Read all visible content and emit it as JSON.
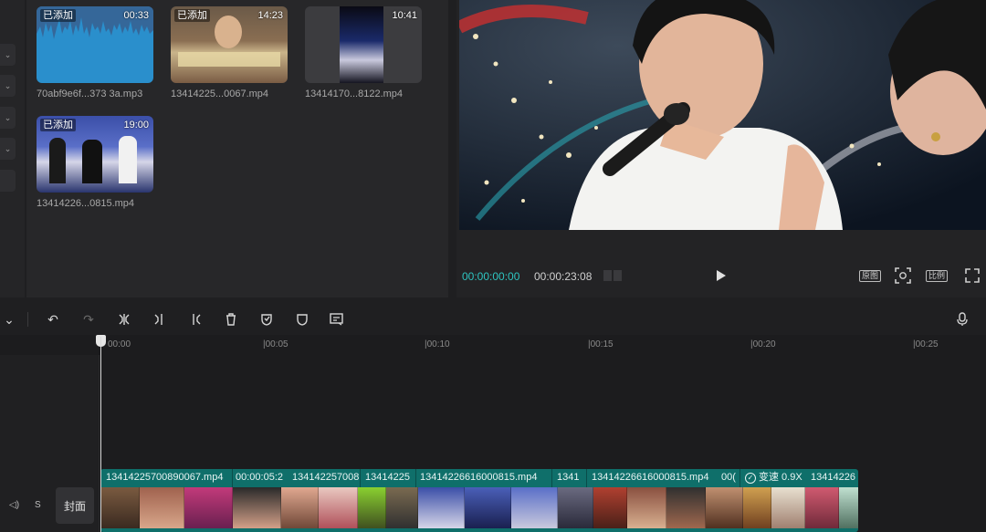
{
  "media": {
    "items": [
      {
        "badge": "已添加",
        "duration": "00:33",
        "filename": "70abf9e6f...373 3a.mp3"
      },
      {
        "badge": "已添加",
        "duration": "14:23",
        "filename": "13414225...0067.mp4"
      },
      {
        "badge": "",
        "duration": "10:41",
        "filename": "13414170...8122.mp4"
      },
      {
        "badge": "已添加",
        "duration": "19:00",
        "filename": "13414226...0815.mp4"
      }
    ]
  },
  "preview": {
    "current_time": "00:00:00:00",
    "total_time": "00:00:23:08",
    "btn_original": "原图",
    "btn_ratio": "比例",
    "colors": {
      "current_time": "#2ec4c0",
      "total_time": "#d0d0d0"
    }
  },
  "ruler": {
    "ticks": [
      "00:00",
      "|00:05",
      "|00:10",
      "|00:15",
      "|00:20",
      "|00:25"
    ]
  },
  "track": {
    "mute_label": "◁)",
    "s_label": "S",
    "cover_label": "封面"
  },
  "clips": [
    {
      "label": "13414225700890067.mp4"
    },
    {
      "label": "00:00:05:2"
    },
    {
      "label": "134142257008"
    },
    {
      "label": "13414225"
    },
    {
      "label": "13414226616000815.mp4"
    },
    {
      "label": "1341"
    },
    {
      "label": "13414226616000815.mp4"
    },
    {
      "label": "00("
    },
    {
      "label": "变速 0.9X"
    },
    {
      "label": "13414226"
    }
  ]
}
